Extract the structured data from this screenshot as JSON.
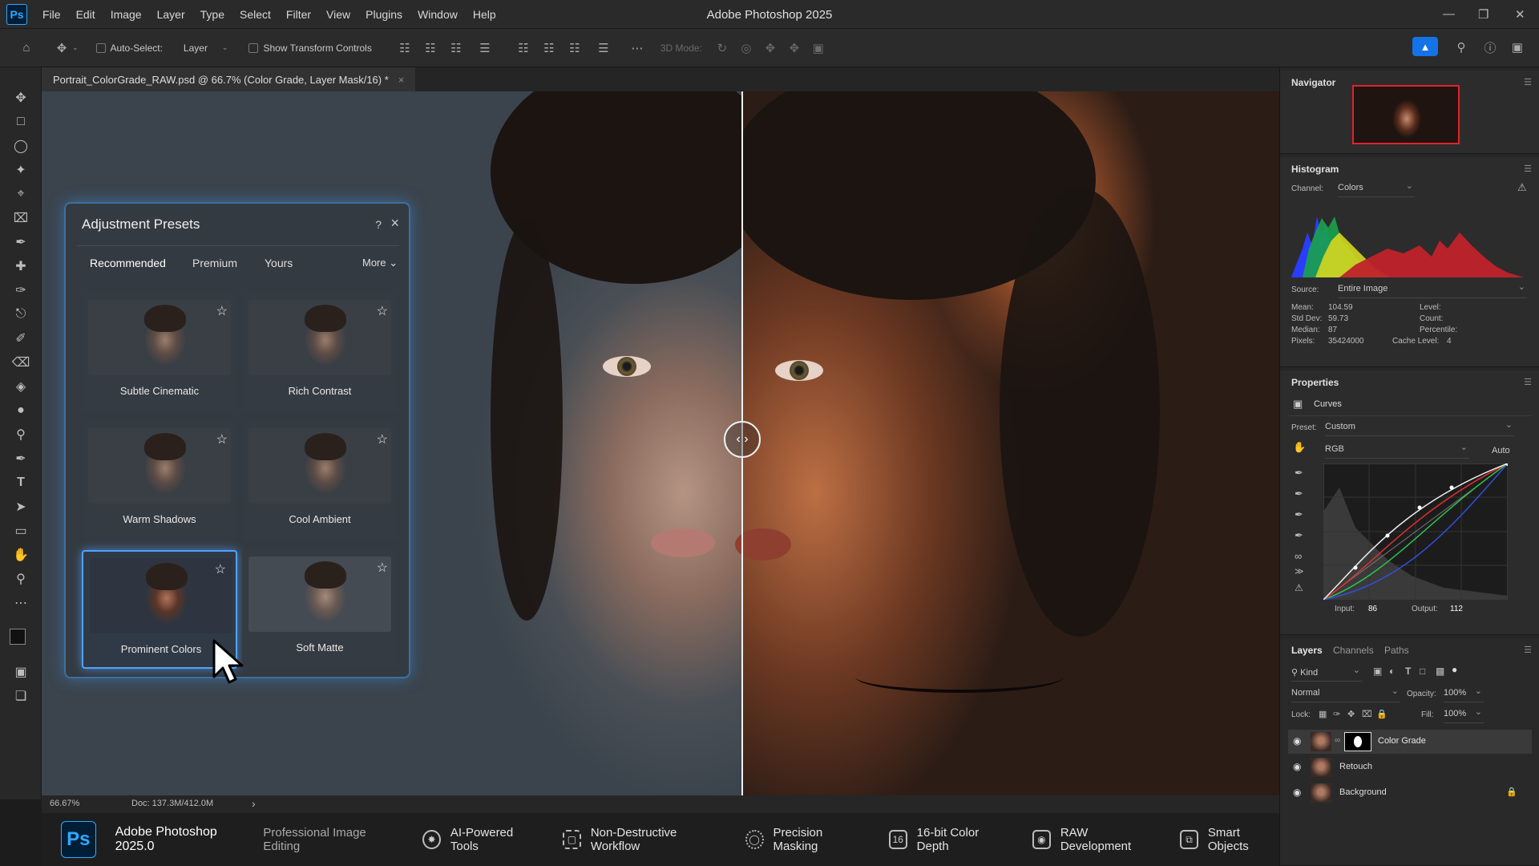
{
  "app": {
    "title": "Adobe Photoshop 2025",
    "logo": "Ps"
  },
  "menu": [
    "File",
    "Edit",
    "Image",
    "Layer",
    "Type",
    "Select",
    "Filter",
    "View",
    "Plugins",
    "Window",
    "Help"
  ],
  "options": {
    "auto_select": "Auto-Select:",
    "layer_dropdown": "Layer",
    "show_transform": "Show Transform Controls",
    "mode_3d": "3D Mode:"
  },
  "document": {
    "tab_title": "Portrait_ColorGrade_RAW.psd @ 66.7% (Color Grade, Layer Mask/16) *",
    "close": "×"
  },
  "status": {
    "zoom": "66.67%",
    "doc": "Doc: 137.3M/412.0M",
    "arrow": "›"
  },
  "presets": {
    "title": "Adjustment Presets",
    "help": "?",
    "close": "×",
    "tabs": [
      "Recommended",
      "Premium",
      "Yours"
    ],
    "more": "More",
    "items": [
      {
        "label": "Subtle Cinematic"
      },
      {
        "label": "Rich Contrast"
      },
      {
        "label": "Warm Shadows"
      },
      {
        "label": "Cool Ambient"
      },
      {
        "label": "Prominent Colors"
      },
      {
        "label": "Soft Matte"
      }
    ],
    "selected_index": 4
  },
  "navigator": {
    "title": "Navigator"
  },
  "histogram": {
    "title": "Histogram",
    "channel_label": "Channel:",
    "channel_value": "Colors",
    "source_label": "Source:",
    "source_value": "Entire Image",
    "stats": {
      "mean_label": "Mean:",
      "mean": "104.59",
      "stddev_label": "Std Dev:",
      "stddev": "59.73",
      "median_label": "Median:",
      "median": "87",
      "pixels_label": "Pixels:",
      "pixels": "35424000",
      "level_label": "Level:",
      "count_label": "Count:",
      "percentile_label": "Percentile:",
      "cache_label": "Cache Level:",
      "cache": "4"
    }
  },
  "properties": {
    "title": "Properties",
    "adjustment": "Curves",
    "preset_label": "Preset:",
    "preset_value": "Custom",
    "channel_value": "RGB",
    "auto": "Auto",
    "input_label": "Input:",
    "input": "86",
    "output_label": "Output:",
    "output": "112"
  },
  "layers": {
    "tabs": [
      "Layers",
      "Channels",
      "Paths"
    ],
    "kind": "Kind",
    "blend": "Normal",
    "opacity_label": "Opacity:",
    "opacity": "100%",
    "lock_label": "Lock:",
    "fill_label": "Fill:",
    "fill": "100%",
    "items": [
      {
        "name": "Color Grade"
      },
      {
        "name": "Retouch"
      },
      {
        "name": "Background"
      }
    ]
  },
  "featurebar": {
    "logo": "Ps",
    "title": "Adobe Photoshop 2025.0",
    "subtitle": "Professional Image Editing",
    "features": [
      {
        "label": "AI-Powered Tools",
        "icon": "ai-sparkle-icon"
      },
      {
        "label": "Non-Destructive Workflow",
        "icon": "frame-brackets-icon"
      },
      {
        "label": "Precision Masking",
        "icon": "mask-circle-icon"
      },
      {
        "label": "16-bit Color Depth",
        "icon": "bit-depth-icon",
        "glyph": "16"
      },
      {
        "label": "RAW Development",
        "icon": "raw-camera-icon"
      },
      {
        "label": "Smart Objects",
        "icon": "smart-object-icon"
      }
    ]
  },
  "colors": {
    "accent": "#31a8ff",
    "panel": "#2c2c2c",
    "selection": "#4fa3ff"
  }
}
